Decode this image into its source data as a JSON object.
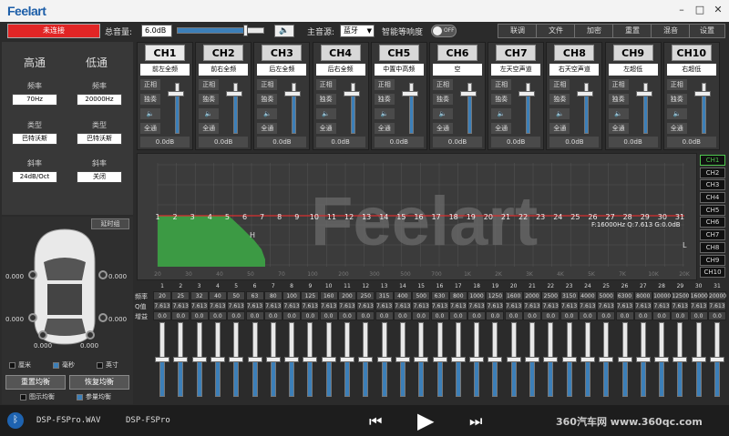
{
  "app": {
    "logo": "Feelart"
  },
  "window": {
    "minimize": "–",
    "maximize": "□",
    "close": "✕"
  },
  "topbar": {
    "status": "未连接",
    "master_volume_label": "总音量:",
    "master_volume_value": "6.0dB",
    "master_volume_level": 0.78,
    "main_source_label": "主音源:",
    "main_source_value": "蓝牙",
    "smart_loudness_label": "智能等响度",
    "smart_loudness_state": "OFF",
    "buttons": [
      "联调",
      "文件",
      "加密",
      "重置",
      "混音",
      "设置"
    ]
  },
  "filters": {
    "high_label": "高通",
    "low_label": "低通",
    "freq_label": "频率",
    "type_label": "类型",
    "slope_label": "斜率",
    "high_freq": "70Hz",
    "low_freq": "20000Hz",
    "high_type": "巴特沃斯",
    "low_type": "巴特沃斯",
    "high_slope": "24dB/Oct",
    "low_slope": "关闭"
  },
  "channels": [
    {
      "name": "CH1",
      "position": "前左全频",
      "db": "0.0dB",
      "level": 0.78
    },
    {
      "name": "CH2",
      "position": "前右全频",
      "db": "0.0dB",
      "level": 0.78
    },
    {
      "name": "CH3",
      "position": "后左全频",
      "db": "0.0dB",
      "level": 0.78
    },
    {
      "name": "CH4",
      "position": "后右全频",
      "db": "0.0dB",
      "level": 0.78
    },
    {
      "name": "CH5",
      "position": "中置中高频",
      "db": "0.0dB",
      "level": 0.78
    },
    {
      "name": "CH6",
      "position": "空",
      "db": "0.0dB",
      "level": 0.78
    },
    {
      "name": "CH7",
      "position": "左天空声道",
      "db": "0.0dB",
      "level": 0.78
    },
    {
      "name": "CH8",
      "position": "右天空声道",
      "db": "0.0dB",
      "level": 0.78
    },
    {
      "name": "CH9",
      "position": "左超低",
      "db": "0.0dB",
      "level": 0.78
    },
    {
      "name": "CH10",
      "position": "右超低",
      "db": "0.0dB",
      "level": 0.78
    }
  ],
  "channel_options": {
    "phase": "正相",
    "solo": "独奏",
    "mute_icon": "speaker-icon",
    "allpass": "全通"
  },
  "graph": {
    "watermark": "Feelart",
    "info": "F:16000Hz Q:7.613 G:0.0dB",
    "marker_h": "H",
    "marker_l": "L",
    "point_labels": [
      "1",
      "2",
      "3",
      "4",
      "5",
      "6",
      "7",
      "8",
      "9",
      "10",
      "11",
      "12",
      "13",
      "14",
      "15",
      "16",
      "17",
      "18",
      "19",
      "20",
      "21",
      "22",
      "23",
      "24",
      "25",
      "26",
      "27",
      "28",
      "29",
      "30",
      "31"
    ],
    "x_axis_labels": [
      "20",
      "30",
      "40",
      "50",
      "70",
      "100",
      "200",
      "300",
      "500",
      "700",
      "1K",
      "2K",
      "3K",
      "4K",
      "5K",
      "7K",
      "10K",
      "20K"
    ]
  },
  "graph_channels": [
    "CH1",
    "CH2",
    "CH3",
    "CH4",
    "CH5",
    "CH6",
    "CH7",
    "CH8",
    "CH9",
    "CH10"
  ],
  "eq": {
    "row_labels": {
      "freq": "频率",
      "q": "Q值",
      "gain": "增益"
    },
    "bands": [
      {
        "n": "1",
        "f": "20",
        "q": "7.613",
        "g": "0.0"
      },
      {
        "n": "2",
        "f": "25",
        "q": "7.613",
        "g": "0.0"
      },
      {
        "n": "3",
        "f": "32",
        "q": "7.613",
        "g": "0.0"
      },
      {
        "n": "4",
        "f": "40",
        "q": "7.613",
        "g": "0.0"
      },
      {
        "n": "5",
        "f": "50",
        "q": "7.613",
        "g": "0.0"
      },
      {
        "n": "6",
        "f": "63",
        "q": "7.613",
        "g": "0.0"
      },
      {
        "n": "7",
        "f": "80",
        "q": "7.613",
        "g": "0.0"
      },
      {
        "n": "8",
        "f": "100",
        "q": "7.613",
        "g": "0.0"
      },
      {
        "n": "9",
        "f": "125",
        "q": "7.613",
        "g": "0.0"
      },
      {
        "n": "10",
        "f": "160",
        "q": "7.613",
        "g": "0.0"
      },
      {
        "n": "11",
        "f": "200",
        "q": "7.613",
        "g": "0.0"
      },
      {
        "n": "12",
        "f": "250",
        "q": "7.613",
        "g": "0.0"
      },
      {
        "n": "13",
        "f": "315",
        "q": "7.613",
        "g": "0.0"
      },
      {
        "n": "14",
        "f": "400",
        "q": "7.613",
        "g": "0.0"
      },
      {
        "n": "15",
        "f": "500",
        "q": "7.613",
        "g": "0.0"
      },
      {
        "n": "16",
        "f": "630",
        "q": "7.613",
        "g": "0.0"
      },
      {
        "n": "17",
        "f": "800",
        "q": "7.613",
        "g": "0.0"
      },
      {
        "n": "18",
        "f": "1000",
        "q": "7.613",
        "g": "0.0"
      },
      {
        "n": "19",
        "f": "1250",
        "q": "7.613",
        "g": "0.0"
      },
      {
        "n": "20",
        "f": "1600",
        "q": "7.613",
        "g": "0.0"
      },
      {
        "n": "21",
        "f": "2000",
        "q": "7.613",
        "g": "0.0"
      },
      {
        "n": "22",
        "f": "2500",
        "q": "7.613",
        "g": "0.0"
      },
      {
        "n": "23",
        "f": "3150",
        "q": "7.613",
        "g": "0.0"
      },
      {
        "n": "24",
        "f": "4000",
        "q": "7.613",
        "g": "0.0"
      },
      {
        "n": "25",
        "f": "5000",
        "q": "7.613",
        "g": "0.0"
      },
      {
        "n": "26",
        "f": "6300",
        "q": "7.613",
        "g": "0.0"
      },
      {
        "n": "27",
        "f": "8000",
        "q": "7.613",
        "g": "0.0"
      },
      {
        "n": "28",
        "f": "10000",
        "q": "7.613",
        "g": "0.0"
      },
      {
        "n": "29",
        "f": "12500",
        "q": "7.613",
        "g": "0.0"
      },
      {
        "n": "30",
        "f": "16000",
        "q": "7.613",
        "g": "0.0"
      },
      {
        "n": "31",
        "f": "20000",
        "q": "7.613",
        "g": "0.0"
      }
    ]
  },
  "delay": {
    "group_label": "延时组",
    "speaker_values": [
      "0.000",
      "0.000",
      "0.000",
      "0.000",
      "0.000",
      "0.000"
    ],
    "unit_cm": "厘米",
    "unit_ms": "毫秒",
    "unit_inch": "英寸",
    "reset_eq": "重置均衡",
    "restore_eq": "恢复均衡",
    "graphic_eq": "图示均衡",
    "param_eq": "参量均衡"
  },
  "player": {
    "file": "DSP-FSPro.WAV",
    "device": "DSP-FSPro",
    "watermark": "360汽车网 www.360qc.com"
  },
  "colors": {
    "accent": "#3c7fb8",
    "status_red": "#e12525",
    "curve_green": "#3c9a44",
    "line_red": "#d83030"
  }
}
